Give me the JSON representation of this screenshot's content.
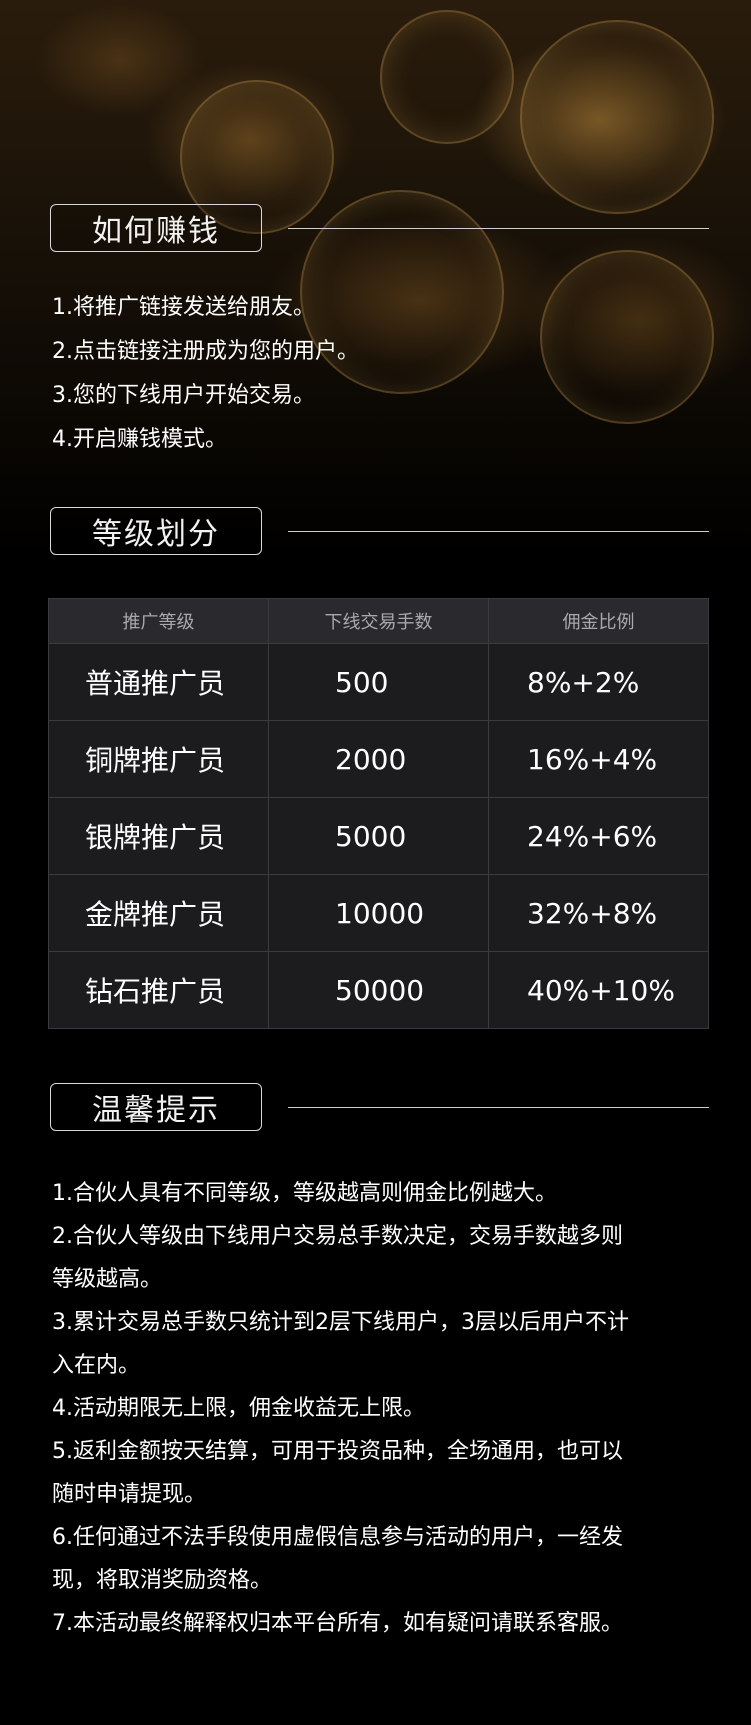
{
  "sections": {
    "earn": {
      "title": "如何赚钱",
      "items": [
        "1.将推广链接发送给朋友。",
        "2.点击链接注册成为您的用户。",
        "3.您的下线用户开始交易。",
        "4.开启赚钱模式。"
      ]
    },
    "grade": {
      "title": "等级划分",
      "table": {
        "headers": [
          "推广等级",
          "下线交易手数",
          "佣金比例"
        ],
        "rows": [
          [
            "普通推广员",
            "500",
            "8%+2%"
          ],
          [
            "铜牌推广员",
            "2000",
            "16%+4%"
          ],
          [
            "银牌推广员",
            "5000",
            "24%+6%"
          ],
          [
            "金牌推广员",
            "10000",
            "32%+8%"
          ],
          [
            "钻石推广员",
            "50000",
            "40%+10%"
          ]
        ]
      }
    },
    "tips": {
      "title": "温馨提示",
      "items": [
        "1.合伙人具有不同等级，等级越高则佣金比例越大。",
        "2.合伙人等级由下线用户交易总手数决定，交易手数越多则",
        "等级越高。",
        "3.累计交易总手数只统计到2层下线用户，3层以后用户不计",
        "入在内。",
        "4.活动期限无上限，佣金收益无上限。",
        "5.返利金额按天结算，可用于投资品种，全场通用，也可以",
        "随时申请提现。",
        "6.任何通过不法手段使用虚假信息参与活动的用户，一经发",
        "现，将取消奖励资格。",
        "7.本活动最终解释权归本平台所有，如有疑问请联系客服。"
      ]
    }
  },
  "colors": {
    "background": "#000000",
    "table_header_bg": "#2a2a2e",
    "table_body_bg": "#1c1c1f",
    "accent_gold": "#c8963c"
  }
}
